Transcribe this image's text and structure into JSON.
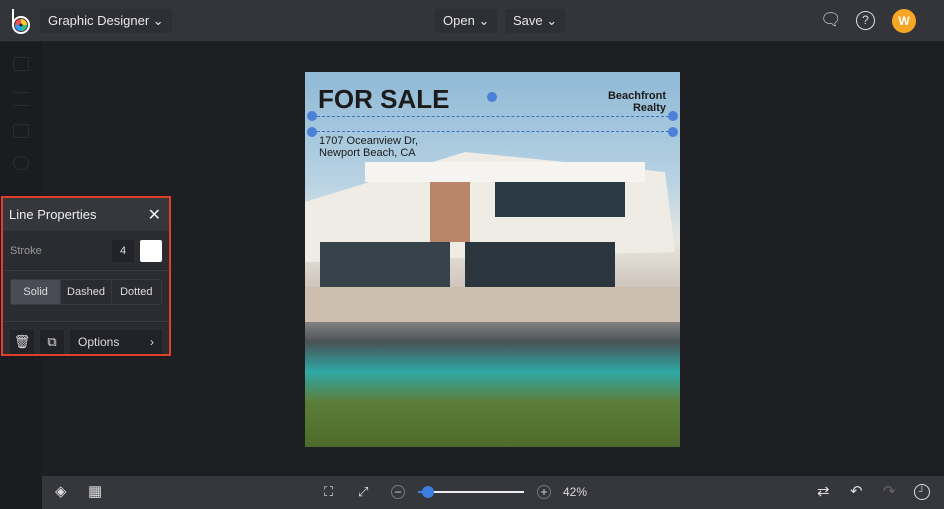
{
  "topbar": {
    "app_menu": "Graphic Designer",
    "open": "Open",
    "save": "Save",
    "avatar": "W",
    "accent": "#f5a623"
  },
  "design": {
    "headline": "FOR SALE",
    "company": "Beachfront Realty",
    "address_line1": "1707 Oceanview Dr,",
    "address_line2": "Newport Beach, CA"
  },
  "panel": {
    "title": "Line Properties",
    "stroke_label": "Stroke",
    "stroke_value": "4",
    "styles": [
      "Solid",
      "Dashed",
      "Dotted"
    ],
    "selected_style": "Solid",
    "options": "Options"
  },
  "bottombar": {
    "zoom": "42%",
    "zoom_fraction": 0.05
  }
}
